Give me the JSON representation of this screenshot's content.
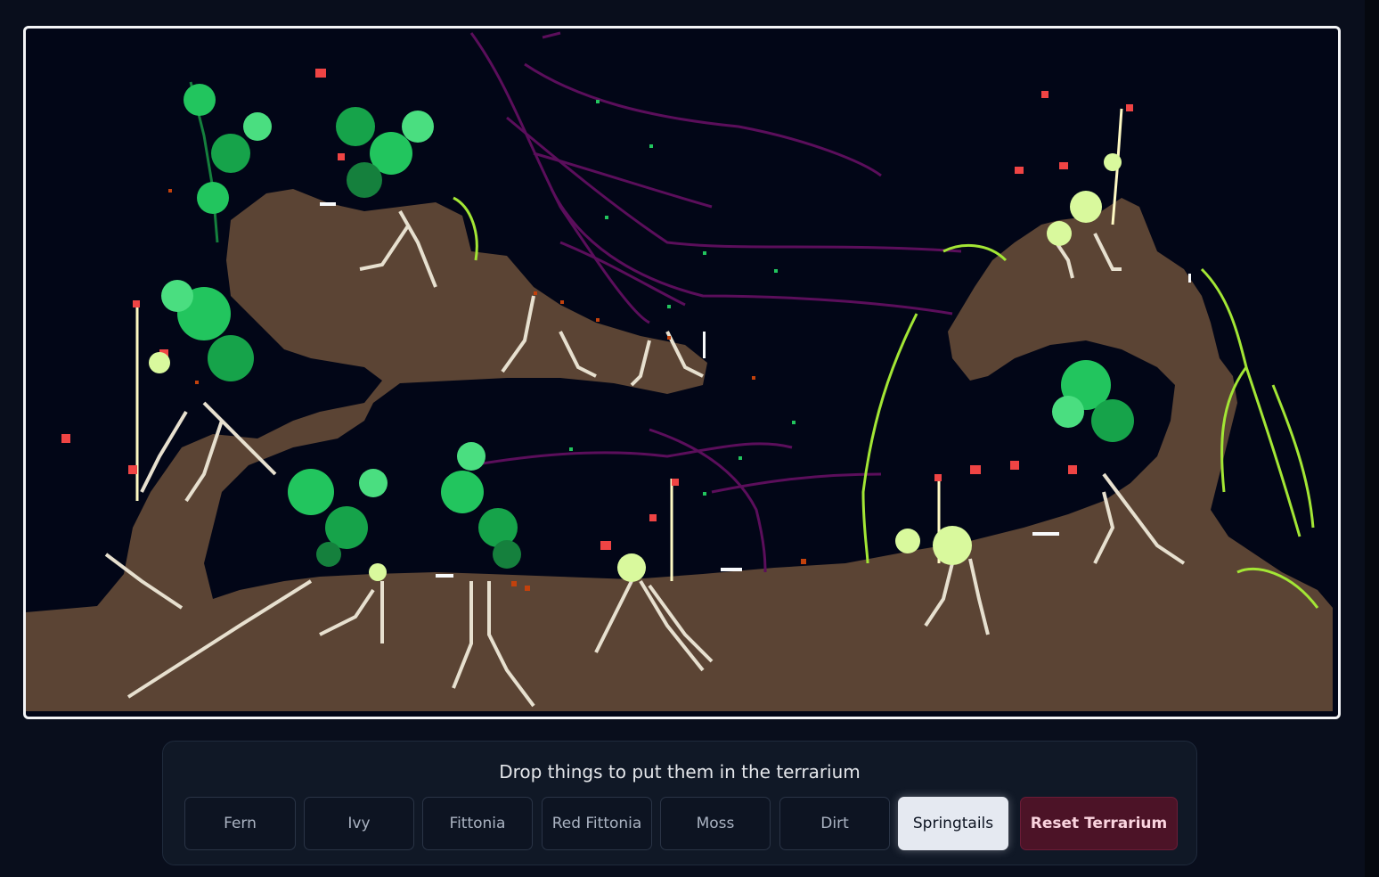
{
  "panel": {
    "title": "Drop things to put them in the terrarium"
  },
  "buttons": [
    {
      "id": "fern",
      "label": "Fern",
      "state": "default"
    },
    {
      "id": "ivy",
      "label": "Ivy",
      "state": "default"
    },
    {
      "id": "fittonia",
      "label": "Fittonia",
      "state": "default"
    },
    {
      "id": "red-fittonia",
      "label": "Red Fittonia",
      "state": "default"
    },
    {
      "id": "moss",
      "label": "Moss",
      "state": "default"
    },
    {
      "id": "dirt",
      "label": "Dirt",
      "state": "default"
    },
    {
      "id": "springtails",
      "label": "Springtails",
      "state": "selected"
    },
    {
      "id": "reset",
      "label": "Reset Terrarium",
      "state": "danger"
    }
  ],
  "colors": {
    "background": "#090e1c",
    "canvas_bg": "#020617",
    "dirt": "#5b4434",
    "root": "#e7e0cf",
    "fern": "#22c55e",
    "ivy": "#a3e635",
    "fittonia_red": "#ef4444",
    "mycelium": "#5b0e5b",
    "selected_button": "#e5e9f1",
    "danger_button": "#4c1327"
  }
}
